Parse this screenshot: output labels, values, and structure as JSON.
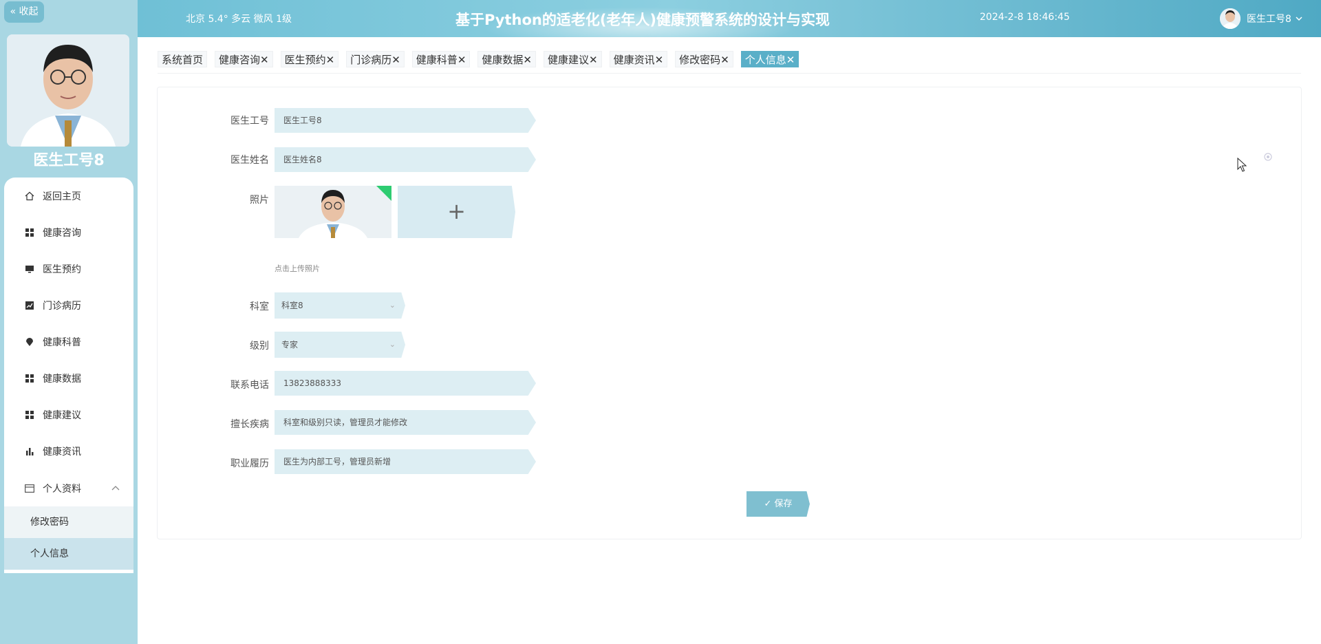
{
  "sidebar": {
    "collapse_label": "« 收起",
    "user_name": "医生工号8",
    "items": [
      {
        "label": "返回主页",
        "icon": "home-icon"
      },
      {
        "label": "健康咨询",
        "icon": "grid-icon"
      },
      {
        "label": "医生预约",
        "icon": "monitor-icon"
      },
      {
        "label": "门诊病历",
        "icon": "chart-icon"
      },
      {
        "label": "健康科普",
        "icon": "pin-icon"
      },
      {
        "label": "健康数据",
        "icon": "grid-icon"
      },
      {
        "label": "健康建议",
        "icon": "grid-icon"
      },
      {
        "label": "健康资讯",
        "icon": "bar-chart-icon"
      },
      {
        "label": "个人资料",
        "icon": "card-icon"
      }
    ],
    "subitems": [
      {
        "label": "修改密码"
      },
      {
        "label": "个人信息"
      }
    ]
  },
  "header": {
    "weather": "北京  5.4°  多云  微风  1级",
    "title": "基于Python的适老化(老年人)健康预警系统的设计与实现",
    "datetime": "2024-2-8 18:46:45",
    "user": "医生工号8"
  },
  "tabs": [
    {
      "label": "系统首页",
      "closable": false
    },
    {
      "label": "健康咨询",
      "closable": true
    },
    {
      "label": "医生预约",
      "closable": true
    },
    {
      "label": "门诊病历",
      "closable": true
    },
    {
      "label": "健康科普",
      "closable": true
    },
    {
      "label": "健康数据",
      "closable": true
    },
    {
      "label": "健康建议",
      "closable": true
    },
    {
      "label": "健康资讯",
      "closable": true
    },
    {
      "label": "修改密码",
      "closable": true
    },
    {
      "label": "个人信息",
      "closable": true,
      "active": true
    }
  ],
  "form": {
    "doctor_id_label": "医生工号",
    "doctor_id_value": "医生工号8",
    "doctor_name_label": "医生姓名",
    "doctor_name_value": "医生姓名8",
    "photo_label": "照片",
    "photo_hint": "点击上传照片",
    "department_label": "科室",
    "department_value": "科室8",
    "level_label": "级别",
    "level_value": "专家",
    "phone_label": "联系电话",
    "phone_value": "13823888333",
    "specialty_label": "擅长疾病",
    "specialty_value": "科室和级别只读，管理员才能修改",
    "career_label": "职业履历",
    "career_value": "医生为内部工号，管理员新增",
    "save_label": "✓ 保存"
  },
  "colors": {
    "sidebar_bg": "#a9d7e3",
    "header_bg": "#6fc0d6",
    "accent": "#5aafc8",
    "field_bg": "#ddeef3",
    "save_bg": "#7fbfd0"
  }
}
